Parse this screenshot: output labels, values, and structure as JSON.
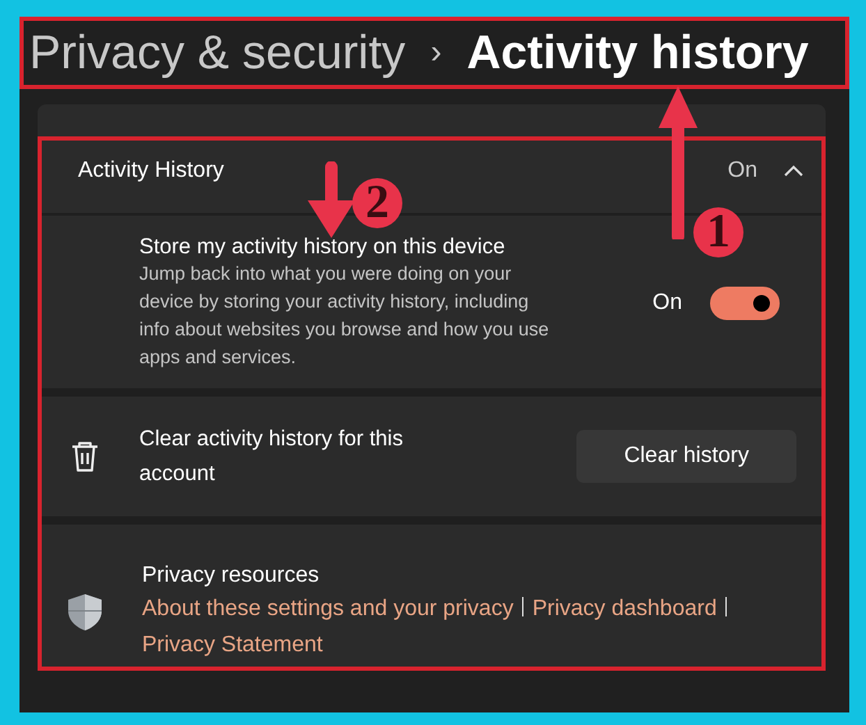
{
  "breadcrumb": {
    "parent": "Privacy & security",
    "separator": "›",
    "current": "Activity history"
  },
  "section": {
    "title": "Activity History",
    "status": "On",
    "expanded": true,
    "store": {
      "title": "Store my activity history on this device",
      "description": "Jump back into what you were doing on your device by storing your activity history, including info about websites you browse and how you use apps and services.",
      "toggle_label": "On",
      "on": true
    },
    "clear": {
      "title": "Clear activity history for this account",
      "button": "Clear history"
    },
    "resources": {
      "title": "Privacy resources",
      "links": [
        "About these settings and your privacy",
        "Privacy dashboard",
        "Privacy Statement"
      ]
    }
  },
  "markers": [
    {
      "label": "1"
    },
    {
      "label": "2"
    }
  ]
}
